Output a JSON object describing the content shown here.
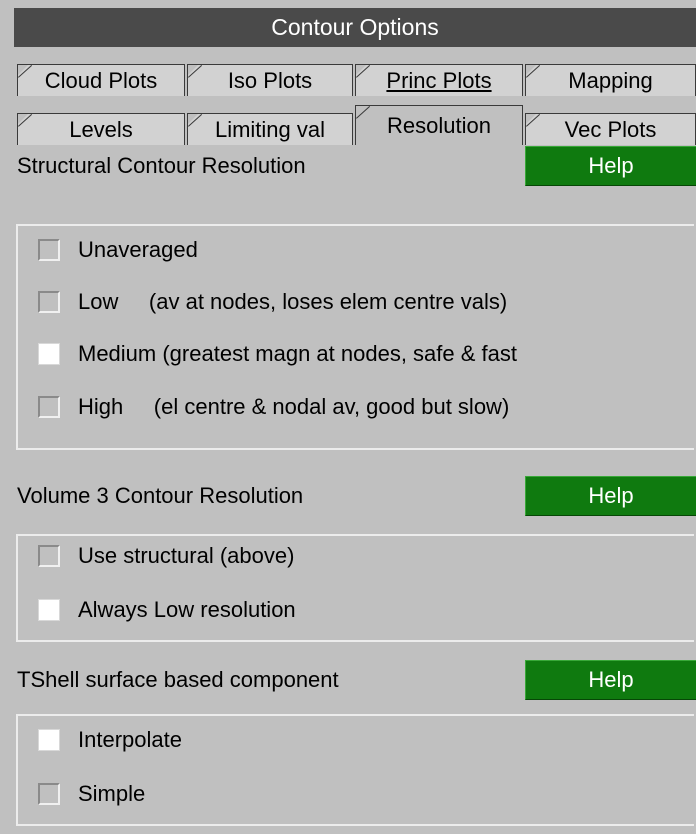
{
  "window": {
    "title": "Contour Options"
  },
  "tabs": {
    "cloud_plots": "Cloud Plots",
    "iso_plots": "Iso Plots",
    "princ_plots": "Princ Plots",
    "mapping": "Mapping",
    "levels": "Levels",
    "limiting_val": "Limiting val",
    "resolution": "Resolution",
    "vec_plots": "Vec Plots",
    "active": "Resolution"
  },
  "structural": {
    "label": "Structural Contour Resolution",
    "help": "Help",
    "options": [
      {
        "text": "Unaveraged",
        "checked": false
      },
      {
        "text": "Low     (av at nodes, loses elem centre vals)",
        "checked": false
      },
      {
        "text": "Medium (greatest magn at nodes, safe & fast",
        "checked": true
      },
      {
        "text": "High     (el centre & nodal av, good but slow)",
        "checked": false
      }
    ]
  },
  "volume3": {
    "label": "Volume 3 Contour Resolution",
    "help": "Help",
    "options": [
      {
        "text": "Use structural (above)",
        "checked": false
      },
      {
        "text": "Always Low resolution",
        "checked": true
      }
    ]
  },
  "tshell": {
    "label": "TShell surface based component",
    "help": "Help",
    "options": [
      {
        "text": "Interpolate",
        "checked": true
      },
      {
        "text": "Simple",
        "checked": false
      }
    ]
  },
  "colors": {
    "title_bg": "#4a4a4a",
    "panel_bg": "#c0c0c0",
    "help_green": "#0f7a0f"
  }
}
